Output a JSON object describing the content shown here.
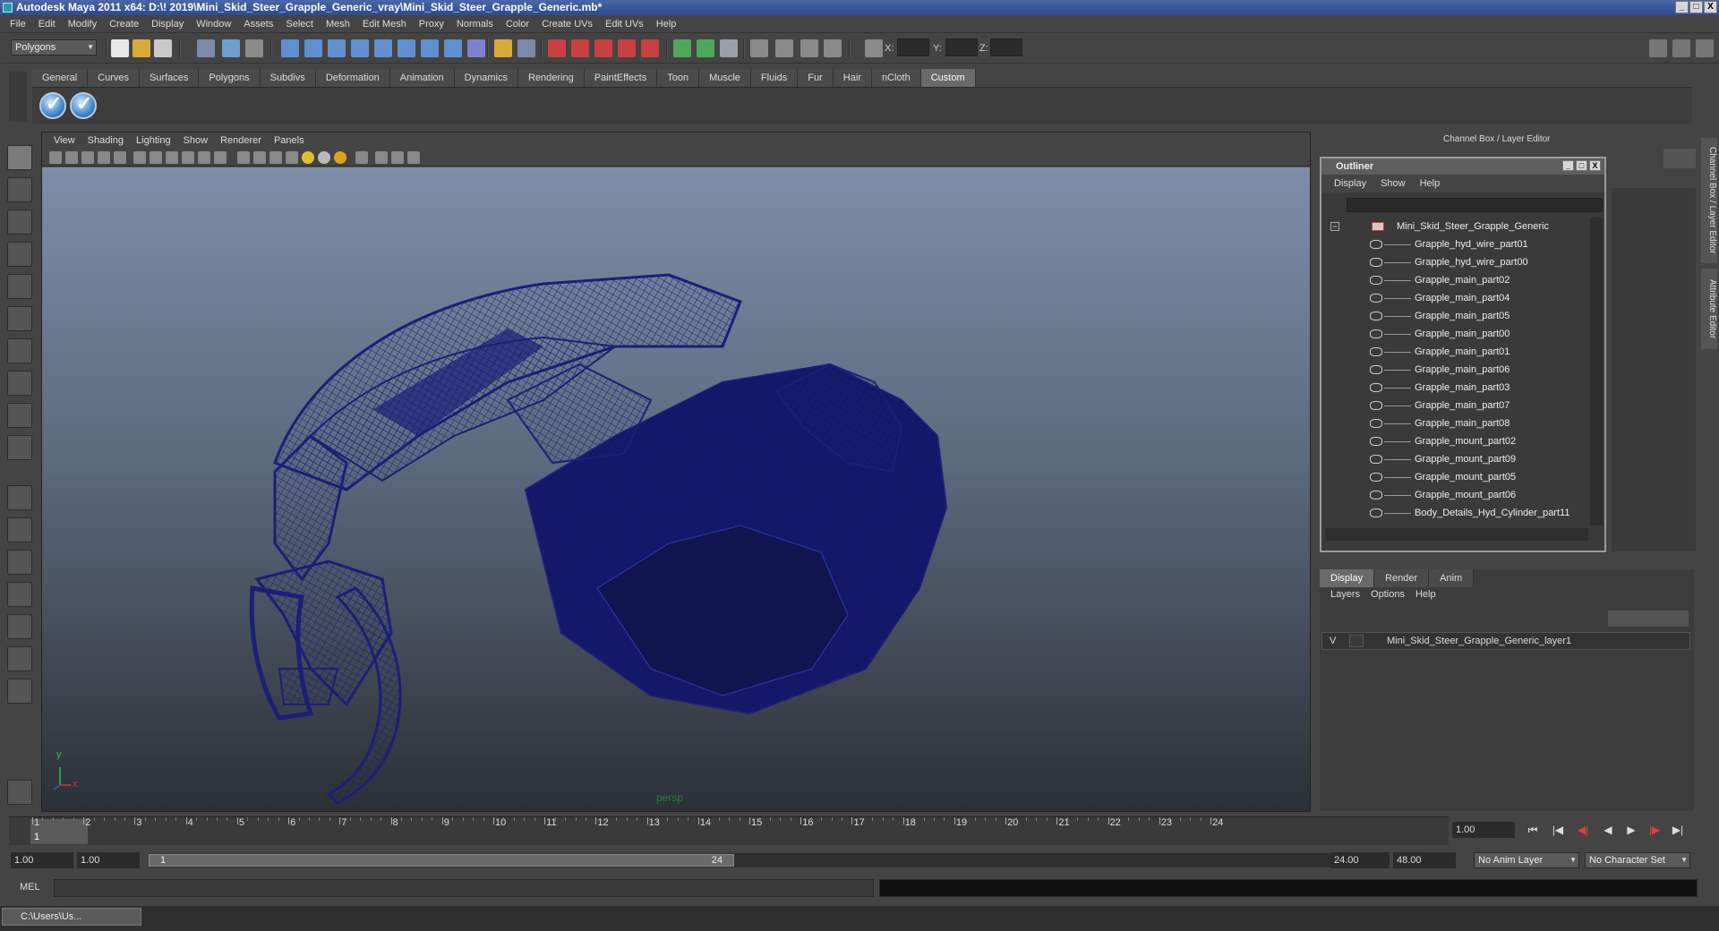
{
  "window": {
    "title": "Autodesk Maya 2011 x64: D:\\! 2019\\Mini_Skid_Steer_Grapple_Generic_vray\\Mini_Skid_Steer_Grapple_Generic.mb*",
    "min_label": "_",
    "max_label": "□",
    "close_label": "X"
  },
  "menubar": [
    "File",
    "Edit",
    "Modify",
    "Create",
    "Display",
    "Window",
    "Assets",
    "Select",
    "Mesh",
    "Edit Mesh",
    "Proxy",
    "Normals",
    "Color",
    "Create UVs",
    "Edit UVs",
    "Help"
  ],
  "statusline": {
    "mode": "Polygons",
    "x_label": "X:",
    "y_label": "Y:",
    "z_label": "Z:"
  },
  "shelf": {
    "tabs": [
      "General",
      "Curves",
      "Surfaces",
      "Polygons",
      "Subdivs",
      "Deformation",
      "Animation",
      "Dynamics",
      "Rendering",
      "PaintEffects",
      "Toon",
      "Muscle",
      "Fluids",
      "Fur",
      "Hair",
      "nCloth",
      "Custom"
    ],
    "active_tab": "Custom"
  },
  "viewport": {
    "menu": [
      "View",
      "Shading",
      "Lighting",
      "Show",
      "Renderer",
      "Panels"
    ],
    "camera_label": "persp",
    "axis_y": "y",
    "axis_x": "x",
    "wire_color": "#1b1f78"
  },
  "channel_box_title": "Channel Box / Layer Editor",
  "side_tabs": [
    "Channel Box / Layer Editor",
    "Attribute Editor"
  ],
  "outliner": {
    "title": "Outliner",
    "menu": [
      "Display",
      "Show",
      "Help"
    ],
    "root": "Mini_Skid_Steer_Grapple_Generic",
    "items": [
      "Grapple_hyd_wire_part01",
      "Grapple_hyd_wire_part00",
      "Grapple_main_part02",
      "Grapple_main_part04",
      "Grapple_main_part05",
      "Grapple_main_part00",
      "Grapple_main_part01",
      "Grapple_main_part06",
      "Grapple_main_part03",
      "Grapple_main_part07",
      "Grapple_main_part08",
      "Grapple_mount_part02",
      "Grapple_mount_part09",
      "Grapple_mount_part05",
      "Grapple_mount_part06",
      "Body_Details_Hyd_Cylinder_part11"
    ]
  },
  "layer_editor": {
    "tabs": [
      "Display",
      "Render",
      "Anim"
    ],
    "active_tab": "Display",
    "menu": [
      "Layers",
      "Options",
      "Help"
    ],
    "layer_visible": "V",
    "layer_name": "Mini_Skid_Steer_Grapple_Generic_layer1"
  },
  "timeline": {
    "ticks": [
      "1",
      "2",
      "3",
      "4",
      "5",
      "6",
      "7",
      "8",
      "9",
      "10",
      "11",
      "12",
      "13",
      "14",
      "15",
      "16",
      "17",
      "18",
      "19",
      "20",
      "21",
      "22",
      "23",
      "24"
    ],
    "current_frame": "1",
    "current_time_field": "1.00"
  },
  "range": {
    "start_time": "1.00",
    "playback_start": "1.00",
    "slider_start": "1",
    "slider_end": "24",
    "playback_end": "24.00",
    "end_time": "48.00",
    "anim_layer": "No Anim Layer",
    "character_set": "No Character Set"
  },
  "command_line": {
    "label": "MEL"
  },
  "taskbar": {
    "task_label": "C:\\Users\\Us..."
  }
}
